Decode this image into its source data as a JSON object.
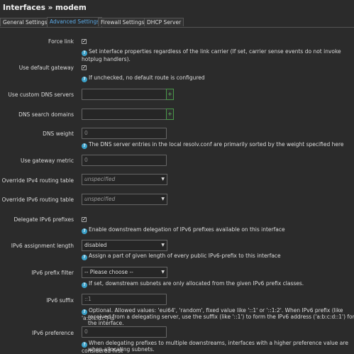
{
  "page": {
    "title": "Interfaces » modem"
  },
  "tabs": [
    {
      "label": "General Settings",
      "active": false
    },
    {
      "label": "Advanced Settings",
      "active": true
    },
    {
      "label": "Firewall Settings",
      "active": false
    },
    {
      "label": "DHCP Server",
      "active": false
    }
  ],
  "fields": {
    "force_link": {
      "label": "Force link",
      "checked": true,
      "help": "Set interface properties regardless of the link carrier (If set, carrier sense events do not invoke hotplug handlers)."
    },
    "use_default_gateway": {
      "label": "Use default gateway",
      "checked": true,
      "help": "If unchecked, no default route is configured"
    },
    "custom_dns": {
      "label": "Use custom DNS servers",
      "value": "",
      "add_icon": "plus-icon"
    },
    "dns_search": {
      "label": "DNS search domains",
      "value": "",
      "add_icon": "plus-icon"
    },
    "dns_weight": {
      "label": "DNS weight",
      "placeholder": "0",
      "help": "The DNS server entries in the local resolv.conf are primarily sorted by the weight specified here"
    },
    "gateway_metric": {
      "label": "Use gateway metric",
      "placeholder": "0"
    },
    "ipv4_table": {
      "label": "Override IPv4 routing table",
      "value": "unspecified"
    },
    "ipv6_table": {
      "label": "Override IPv6 routing table",
      "value": "unspecified"
    },
    "delegate_prefixes": {
      "label": "Delegate IPv6 prefixes",
      "checked": true,
      "help": "Enable downstream delegation of IPv6 prefixes available on this interface"
    },
    "ipv6_assign_length": {
      "label": "IPv6 assignment length",
      "value": "disabled",
      "help": "Assign a part of given length of every public IPv6-prefix to this interface"
    },
    "ipv6_prefix_filter": {
      "label": "IPv6 prefix filter",
      "value": "-- Please choose --",
      "help": "If set, downstream subnets are only allocated from the given IPv6 prefix classes."
    },
    "ipv6_suffix": {
      "label": "IPv6 suffix",
      "placeholder": "::1",
      "help_line1": "Optional. Allowed values: 'eui64', 'random', fixed value like '::1' or '::1:2'. When IPv6 prefix (like 'a:b:c:d::') is",
      "help_line2": "received from a delegating server, use the suffix (like '::1') to form the IPv6 address ('a:b:c:d::1') for the interface."
    },
    "ipv6_preference": {
      "label": "IPv6 preference",
      "placeholder": "0",
      "help_line1": "When delegating prefixes to multiple downstreams, interfaces with a higher preference value are considered first",
      "help_line2": "when allocating subnets."
    }
  },
  "colors": {
    "accent": "#5aa9e6",
    "help_icon": "#3aa0c8",
    "add_button": "#5fbf5f",
    "background": "#2b2b2b"
  },
  "icons": {
    "help": "question-icon",
    "dropdown": "chevron-down-icon",
    "check": "checkmark-icon"
  }
}
